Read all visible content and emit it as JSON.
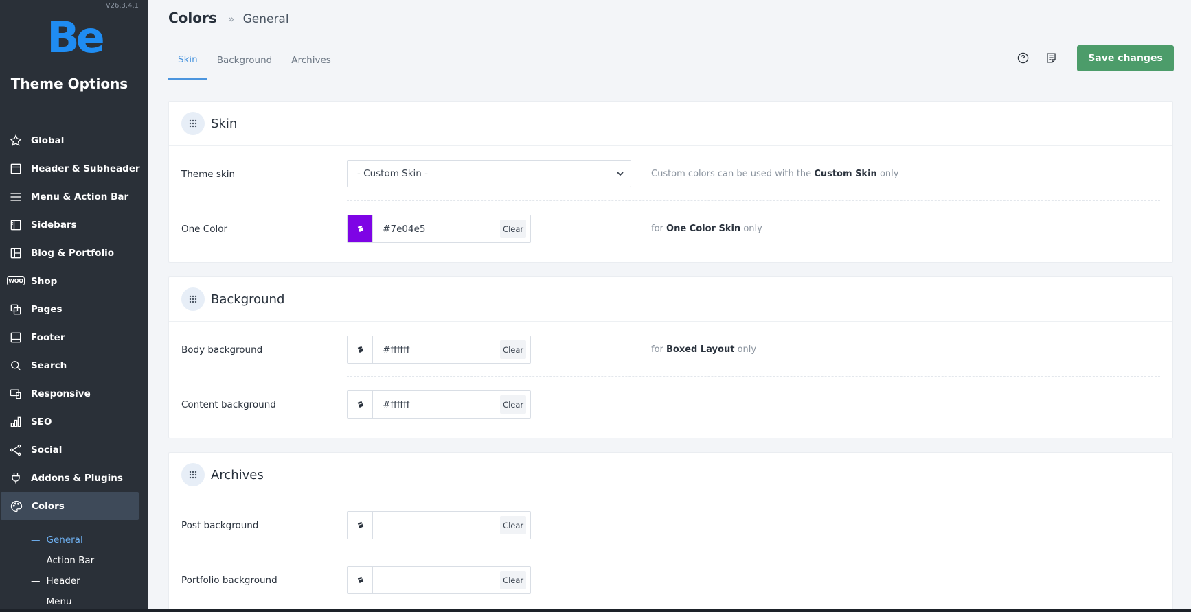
{
  "sidebar": {
    "version": "V26.3.4.1",
    "logo": "Be",
    "title": "Theme Options",
    "items": [
      {
        "label": "Global",
        "icon": "star-icon"
      },
      {
        "label": "Header & Subheader",
        "icon": "header-layout-icon"
      },
      {
        "label": "Menu & Action Bar",
        "icon": "menu-lines-icon"
      },
      {
        "label": "Sidebars",
        "icon": "sidebar-layout-icon"
      },
      {
        "label": "Blog & Portfolio",
        "icon": "grid-layout-icon"
      },
      {
        "label": "Shop",
        "icon": "woo-icon",
        "badge": "WOO"
      },
      {
        "label": "Pages",
        "icon": "pages-icon"
      },
      {
        "label": "Footer",
        "icon": "footer-layout-icon"
      },
      {
        "label": "Search",
        "icon": "search-icon"
      },
      {
        "label": "Responsive",
        "icon": "responsive-icon"
      },
      {
        "label": "SEO",
        "icon": "bar-chart-icon"
      },
      {
        "label": "Social",
        "icon": "share-icon"
      },
      {
        "label": "Addons & Plugins",
        "icon": "plug-icon"
      },
      {
        "label": "Colors",
        "icon": "palette-icon",
        "active": true
      }
    ],
    "subitems": [
      {
        "label": "General",
        "active": true
      },
      {
        "label": "Action Bar"
      },
      {
        "label": "Header"
      },
      {
        "label": "Menu"
      }
    ]
  },
  "header": {
    "title": "Colors",
    "separator": "»",
    "subtitle": "General",
    "tabs": [
      {
        "label": "Skin",
        "active": true
      },
      {
        "label": "Background"
      },
      {
        "label": "Archives"
      }
    ],
    "save_label": "Save changes"
  },
  "cards": {
    "skin": {
      "title": "Skin",
      "theme_skin": {
        "label": "Theme skin",
        "value": "- Custom Skin -",
        "desc_pre": "Custom colors can be used with the",
        "desc_bold": "Custom Skin",
        "desc_post": "only"
      },
      "one_color": {
        "label": "One Color",
        "value": "#7e04e5",
        "swatch": "#7e04e5",
        "clear": "Clear",
        "desc_pre": "for",
        "desc_bold": "One Color Skin",
        "desc_post": "only"
      }
    },
    "background": {
      "title": "Background",
      "body": {
        "label": "Body background",
        "value": "#ffffff",
        "clear": "Clear",
        "desc_pre": "for",
        "desc_bold": "Boxed Layout",
        "desc_post": "only"
      },
      "content": {
        "label": "Content background",
        "value": "#ffffff",
        "clear": "Clear"
      }
    },
    "archives": {
      "title": "Archives",
      "post": {
        "label": "Post background",
        "value": "",
        "clear": "Clear"
      },
      "portfolio": {
        "label": "Portfolio background",
        "value": "",
        "clear": "Clear"
      }
    }
  },
  "colors": {
    "sidebar_bg": "#2a3038",
    "accent": "#4b95de",
    "save": "#4c9c6a",
    "logo": "#1f8cf2"
  }
}
